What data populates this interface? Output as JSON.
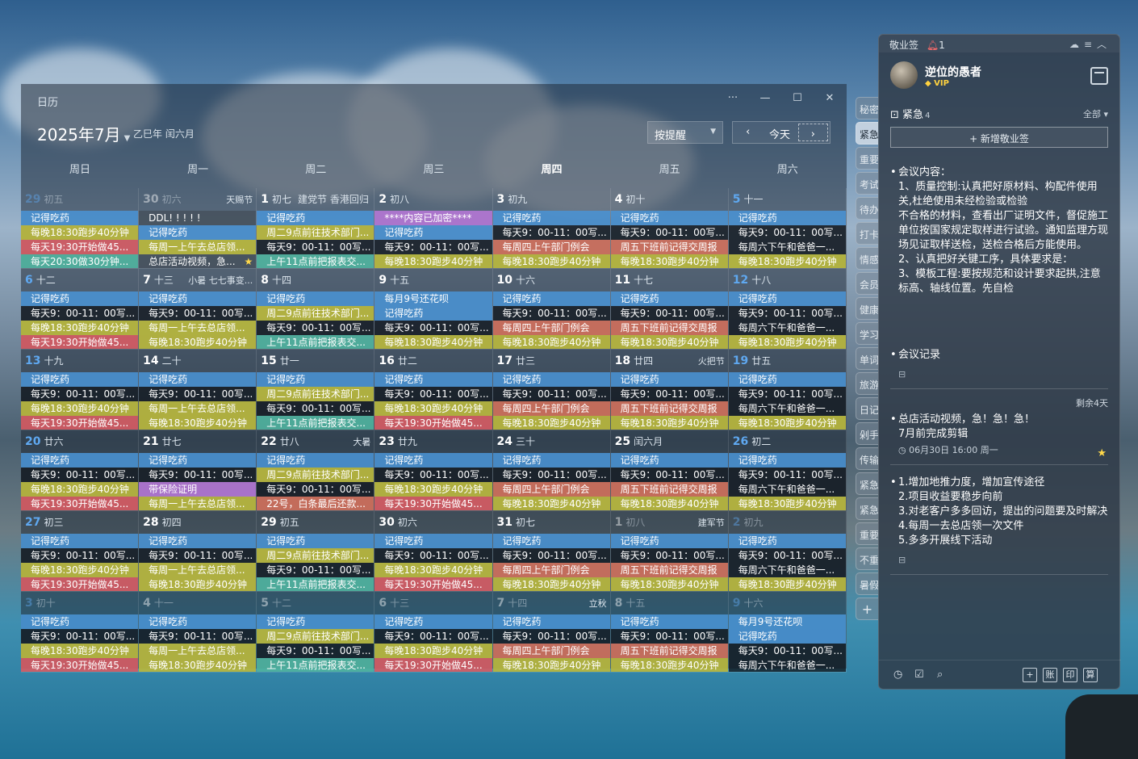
{
  "calendar": {
    "window_title": "日历",
    "controls": {
      "more": "···",
      "min": "—",
      "max": "☐",
      "close": "✕"
    },
    "month_title": "2025年7月",
    "lunar_info": "乙巳年 闰六月",
    "sort_select": "按提醒",
    "today_label": "今天",
    "weekdays": [
      "周日",
      "周一",
      "周二",
      "周三",
      "周四",
      "周五",
      "周六"
    ],
    "days": [
      {
        "d": "29",
        "l": "初五",
        "dim": true,
        "wk": true,
        "ev": [
          [
            "记得吃药",
            "blue"
          ],
          [
            "每晚18:30跑步40分钟",
            "yel"
          ],
          [
            "每天19:30开始做45...",
            "red"
          ],
          [
            "每天20:30做30分钟...",
            "teal"
          ]
        ]
      },
      {
        "d": "30",
        "l": "初六",
        "f": "天赐节",
        "dim": true,
        "ev": [
          [
            "DDL! ! ! ! !",
            "gray"
          ],
          [
            "记得吃药",
            "blue"
          ],
          [
            "每周一上午去总店领...",
            "yel"
          ],
          [
            "总店活动视频，急...",
            "gray",
            true
          ]
        ]
      },
      {
        "d": "1",
        "l": "初七",
        "f2": "建党节 香港回归",
        "ev": [
          [
            "记得吃药",
            "blue"
          ],
          [
            "周二9点前往技术部门...",
            "yel"
          ],
          [
            "每天9：00-11：00写...",
            "dark"
          ],
          [
            "上午11点前把报表交...",
            "teal"
          ]
        ]
      },
      {
        "d": "2",
        "l": "初八",
        "ev": [
          [
            "****内容已加密****",
            "purp"
          ],
          [
            "记得吃药",
            "blue"
          ],
          [
            "每天9：00-11：00写...",
            "dark"
          ],
          [
            "每晚18:30跑步40分钟",
            "yel"
          ]
        ]
      },
      {
        "d": "3",
        "l": "初九",
        "ev": [
          [
            "记得吃药",
            "blue"
          ],
          [
            "每天9：00-11：00写...",
            "dark"
          ],
          [
            "每周四上午部门例会",
            "pink"
          ],
          [
            "每晚18:30跑步40分钟",
            "yel"
          ]
        ]
      },
      {
        "d": "4",
        "l": "初十",
        "ev": [
          [
            "记得吃药",
            "blue"
          ],
          [
            "每天9：00-11：00写...",
            "dark"
          ],
          [
            "周五下班前记得交周报",
            "pink"
          ],
          [
            "每晚18:30跑步40分钟",
            "yel"
          ]
        ]
      },
      {
        "d": "5",
        "l": "十一",
        "wk": true,
        "ev": [
          [
            "记得吃药",
            "blue"
          ],
          [
            "每天9：00-11：00写...",
            "dark"
          ],
          [
            "每周六下午和爸爸一...",
            "dark"
          ],
          [
            "每晚18:30跑步40分钟",
            "yel"
          ]
        ]
      },
      {
        "d": "6",
        "l": "十二",
        "wk": true,
        "ev": [
          [
            "记得吃药",
            "blue"
          ],
          [
            "每天9：00-11：00写...",
            "dark"
          ],
          [
            "每晚18:30跑步40分钟",
            "yel"
          ],
          [
            "每天19:30开始做45...",
            "red"
          ]
        ]
      },
      {
        "d": "7",
        "l": "十三",
        "f": "小暑 七七事变...",
        "ev": [
          [
            "记得吃药",
            "blue"
          ],
          [
            "每天9：00-11：00写...",
            "dark"
          ],
          [
            "每周一上午去总店领...",
            "yel"
          ],
          [
            "每晚18:30跑步40分钟",
            "yel"
          ]
        ]
      },
      {
        "d": "8",
        "l": "十四",
        "ev": [
          [
            "记得吃药",
            "blue"
          ],
          [
            "周二9点前往技术部门...",
            "yel"
          ],
          [
            "每天9：00-11：00写...",
            "dark"
          ],
          [
            "上午11点前把报表交...",
            "teal"
          ]
        ]
      },
      {
        "d": "9",
        "l": "十五",
        "ev": [
          [
            "每月9号还花呗",
            "blue"
          ],
          [
            "记得吃药",
            "blue"
          ],
          [
            "每天9：00-11：00写...",
            "dark"
          ],
          [
            "每晚18:30跑步40分钟",
            "yel"
          ]
        ]
      },
      {
        "d": "10",
        "l": "十六",
        "ev": [
          [
            "记得吃药",
            "blue"
          ],
          [
            "每天9：00-11：00写...",
            "dark"
          ],
          [
            "每周四上午部门例会",
            "pink"
          ],
          [
            "每晚18:30跑步40分钟",
            "yel"
          ]
        ]
      },
      {
        "d": "11",
        "l": "十七",
        "ev": [
          [
            "记得吃药",
            "blue"
          ],
          [
            "每天9：00-11：00写...",
            "dark"
          ],
          [
            "周五下班前记得交周报",
            "pink"
          ],
          [
            "每晚18:30跑步40分钟",
            "yel"
          ]
        ]
      },
      {
        "d": "12",
        "l": "十八",
        "wk": true,
        "ev": [
          [
            "记得吃药",
            "blue"
          ],
          [
            "每天9：00-11：00写...",
            "dark"
          ],
          [
            "每周六下午和爸爸一...",
            "dark"
          ],
          [
            "每晚18:30跑步40分钟",
            "yel"
          ]
        ]
      },
      {
        "d": "13",
        "l": "十九",
        "wk": true,
        "ev": [
          [
            "记得吃药",
            "blue"
          ],
          [
            "每天9：00-11：00写...",
            "dark"
          ],
          [
            "每晚18:30跑步40分钟",
            "yel"
          ],
          [
            "每天19:30开始做45...",
            "red"
          ]
        ]
      },
      {
        "d": "14",
        "l": "二十",
        "ev": [
          [
            "记得吃药",
            "blue"
          ],
          [
            "每天9：00-11：00写...",
            "dark"
          ],
          [
            "每周一上午去总店领...",
            "yel"
          ],
          [
            "每晚18:30跑步40分钟",
            "yel"
          ]
        ]
      },
      {
        "d": "15",
        "l": "廿一",
        "ev": [
          [
            "记得吃药",
            "blue"
          ],
          [
            "周二9点前往技术部门...",
            "yel"
          ],
          [
            "每天9：00-11：00写...",
            "dark"
          ],
          [
            "上午11点前把报表交...",
            "teal"
          ]
        ]
      },
      {
        "d": "16",
        "l": "廿二",
        "ev": [
          [
            "记得吃药",
            "blue"
          ],
          [
            "每天9：00-11：00写...",
            "dark"
          ],
          [
            "每晚18:30跑步40分钟",
            "yel"
          ],
          [
            "每天19:30开始做45...",
            "red"
          ]
        ]
      },
      {
        "d": "17",
        "l": "廿三",
        "ev": [
          [
            "记得吃药",
            "blue"
          ],
          [
            "每天9：00-11：00写...",
            "dark"
          ],
          [
            "每周四上午部门例会",
            "pink"
          ],
          [
            "每晚18:30跑步40分钟",
            "yel"
          ]
        ]
      },
      {
        "d": "18",
        "l": "廿四",
        "f": "火把节",
        "ev": [
          [
            "记得吃药",
            "blue"
          ],
          [
            "每天9：00-11：00写...",
            "dark"
          ],
          [
            "周五下班前记得交周报",
            "pink"
          ],
          [
            "每晚18:30跑步40分钟",
            "yel"
          ]
        ]
      },
      {
        "d": "19",
        "l": "廿五",
        "wk": true,
        "ev": [
          [
            "记得吃药",
            "blue"
          ],
          [
            "每天9：00-11：00写...",
            "dark"
          ],
          [
            "每周六下午和爸爸一...",
            "dark"
          ],
          [
            "每晚18:30跑步40分钟",
            "yel"
          ]
        ]
      },
      {
        "d": "20",
        "l": "廿六",
        "wk": true,
        "ev": [
          [
            "记得吃药",
            "blue"
          ],
          [
            "每天9：00-11：00写...",
            "dark"
          ],
          [
            "每晚18:30跑步40分钟",
            "yel"
          ],
          [
            "每天19:30开始做45...",
            "red"
          ]
        ]
      },
      {
        "d": "21",
        "l": "廿七",
        "ev": [
          [
            "记得吃药",
            "blue"
          ],
          [
            "每天9：00-11：00写...",
            "dark"
          ],
          [
            "带保险证明",
            "purp"
          ],
          [
            "每周一上午去总店领...",
            "yel"
          ]
        ]
      },
      {
        "d": "22",
        "l": "廿八",
        "f": "大暑",
        "ev": [
          [
            "记得吃药",
            "blue"
          ],
          [
            "周二9点前往技术部门...",
            "yel"
          ],
          [
            "每天9：00-11：00写...",
            "dark"
          ],
          [
            "22号，白条最后还款...",
            "pink"
          ]
        ]
      },
      {
        "d": "23",
        "l": "廿九",
        "ev": [
          [
            "记得吃药",
            "blue"
          ],
          [
            "每天9：00-11：00写...",
            "dark"
          ],
          [
            "每晚18:30跑步40分钟",
            "yel"
          ],
          [
            "每天19:30开始做45...",
            "red"
          ]
        ]
      },
      {
        "d": "24",
        "l": "三十",
        "ev": [
          [
            "记得吃药",
            "blue"
          ],
          [
            "每天9：00-11：00写...",
            "dark"
          ],
          [
            "每周四上午部门例会",
            "pink"
          ],
          [
            "每晚18:30跑步40分钟",
            "yel"
          ]
        ]
      },
      {
        "d": "25",
        "l": "闰六月",
        "ev": [
          [
            "记得吃药",
            "blue"
          ],
          [
            "每天9：00-11：00写...",
            "dark"
          ],
          [
            "周五下班前记得交周报",
            "pink"
          ],
          [
            "每晚18:30跑步40分钟",
            "yel"
          ]
        ]
      },
      {
        "d": "26",
        "l": "初二",
        "wk": true,
        "ev": [
          [
            "记得吃药",
            "blue"
          ],
          [
            "每天9：00-11：00写...",
            "dark"
          ],
          [
            "每周六下午和爸爸一...",
            "dark"
          ],
          [
            "每晚18:30跑步40分钟",
            "yel"
          ]
        ]
      },
      {
        "d": "27",
        "l": "初三",
        "wk": true,
        "ev": [
          [
            "记得吃药",
            "blue"
          ],
          [
            "每天9：00-11：00写...",
            "dark"
          ],
          [
            "每晚18:30跑步40分钟",
            "yel"
          ],
          [
            "每天19:30开始做45...",
            "red"
          ]
        ]
      },
      {
        "d": "28",
        "l": "初四",
        "ev": [
          [
            "记得吃药",
            "blue"
          ],
          [
            "每天9：00-11：00写...",
            "dark"
          ],
          [
            "每周一上午去总店领...",
            "yel"
          ],
          [
            "每晚18:30跑步40分钟",
            "yel"
          ]
        ]
      },
      {
        "d": "29",
        "l": "初五",
        "ev": [
          [
            "记得吃药",
            "blue"
          ],
          [
            "周二9点前往技术部门...",
            "yel"
          ],
          [
            "每天9：00-11：00写...",
            "dark"
          ],
          [
            "上午11点前把报表交...",
            "teal"
          ]
        ]
      },
      {
        "d": "30",
        "l": "初六",
        "ev": [
          [
            "记得吃药",
            "blue"
          ],
          [
            "每天9：00-11：00写...",
            "dark"
          ],
          [
            "每晚18:30跑步40分钟",
            "yel"
          ],
          [
            "每天19:30开始做45...",
            "red"
          ]
        ]
      },
      {
        "d": "31",
        "l": "初七",
        "ev": [
          [
            "记得吃药",
            "blue"
          ],
          [
            "每天9：00-11：00写...",
            "dark"
          ],
          [
            "每周四上午部门例会",
            "pink"
          ],
          [
            "每晚18:30跑步40分钟",
            "yel"
          ]
        ]
      },
      {
        "d": "1",
        "l": "初八",
        "f": "建军节",
        "dim": true,
        "ev": [
          [
            "记得吃药",
            "blue"
          ],
          [
            "每天9：00-11：00写...",
            "dark"
          ],
          [
            "周五下班前记得交周报",
            "pink"
          ],
          [
            "每晚18:30跑步40分钟",
            "yel"
          ]
        ]
      },
      {
        "d": "2",
        "l": "初九",
        "dim": true,
        "wk": true,
        "ev": [
          [
            "记得吃药",
            "blue"
          ],
          [
            "每天9：00-11：00写...",
            "dark"
          ],
          [
            "每周六下午和爸爸一...",
            "dark"
          ],
          [
            "每晚18:30跑步40分钟",
            "yel"
          ]
        ]
      },
      {
        "d": "3",
        "l": "初十",
        "dim": true,
        "wk": true,
        "ev": [
          [
            "记得吃药",
            "blue"
          ],
          [
            "每天9：00-11：00写...",
            "dark"
          ],
          [
            "每晚18:30跑步40分钟",
            "yel"
          ],
          [
            "每天19:30开始做45...",
            "red"
          ]
        ]
      },
      {
        "d": "4",
        "l": "十一",
        "dim": true,
        "ev": [
          [
            "记得吃药",
            "blue"
          ],
          [
            "每天9：00-11：00写...",
            "dark"
          ],
          [
            "每周一上午去总店领...",
            "yel"
          ],
          [
            "每晚18:30跑步40分钟",
            "yel"
          ]
        ]
      },
      {
        "d": "5",
        "l": "十二",
        "dim": true,
        "ev": [
          [
            "记得吃药",
            "blue"
          ],
          [
            "周二9点前往技术部门...",
            "yel"
          ],
          [
            "每天9：00-11：00写...",
            "dark"
          ],
          [
            "上午11点前把报表交...",
            "teal"
          ]
        ]
      },
      {
        "d": "6",
        "l": "十三",
        "dim": true,
        "ev": [
          [
            "记得吃药",
            "blue"
          ],
          [
            "每天9：00-11：00写...",
            "dark"
          ],
          [
            "每晚18:30跑步40分钟",
            "yel"
          ],
          [
            "每天19:30开始做45...",
            "red"
          ]
        ]
      },
      {
        "d": "7",
        "l": "十四",
        "f": "立秋",
        "dim": true,
        "ev": [
          [
            "记得吃药",
            "blue"
          ],
          [
            "每天9：00-11：00写...",
            "dark"
          ],
          [
            "每周四上午部门例会",
            "pink"
          ],
          [
            "每晚18:30跑步40分钟",
            "yel"
          ]
        ]
      },
      {
        "d": "8",
        "l": "十五",
        "dim": true,
        "ev": [
          [
            "记得吃药",
            "blue"
          ],
          [
            "每天9：00-11：00写...",
            "dark"
          ],
          [
            "周五下班前记得交周报",
            "pink"
          ],
          [
            "每晚18:30跑步40分钟",
            "yel"
          ]
        ]
      },
      {
        "d": "9",
        "l": "十六",
        "dim": true,
        "wk": true,
        "ev": [
          [
            "每月9号还花呗",
            "blue"
          ],
          [
            "记得吃药",
            "blue"
          ],
          [
            "每天9：00-11：00写...",
            "dark"
          ],
          [
            "每周六下午和爸爸一...",
            "dark"
          ]
        ]
      }
    ]
  },
  "tabs": [
    "秘密",
    "紧急",
    "重要",
    "考试",
    "待办",
    "打卡",
    "情感",
    "会员",
    "健康",
    "学习",
    "单词",
    "旅游",
    "日记",
    "剁手",
    "传输",
    "紧急",
    "紧急",
    "重要",
    "不重",
    "暑假",
    "+"
  ],
  "notes": {
    "app_name": "敬业签",
    "bell_count": "1",
    "user_name": "逆位的愚者",
    "vip": "VIP",
    "section": "紧急",
    "section_count": "4",
    "filter_all": "全部",
    "new_button": "+ 新增敬业签",
    "note1": [
      "会议内容：",
      "1、质量控制:认真把好原材料、构配件使用关,杜绝使用未经检验或检验",
      "不合格的材料，查看出厂证明文件，督促施工单位按国家规定取样进行试验。通知监理方现场见证取样送检，送检合格后方能使用。",
      "2、认真把好关键工序，具体要求是：",
      "3、模板工程:要按规范和设计要求起拱,注意标高、轴线位置。先自检"
    ],
    "note2": "会议记录",
    "remaining": "剩余4天",
    "note3": [
      "总店活动视频，急！急！急！",
      "7月前完成剪辑"
    ],
    "note3_meta": "06月30日 16:00 周一",
    "note4": [
      "1.增加地推力度，增加宣传途径",
      "2.项目收益要稳步向前",
      "3.对老客户多多回访，提出的问题要及时解决",
      "4.每周一去总店领一次文件",
      "5.多多开展线下活动"
    ],
    "foot_buttons": [
      "+",
      "账",
      "印",
      "算"
    ]
  }
}
